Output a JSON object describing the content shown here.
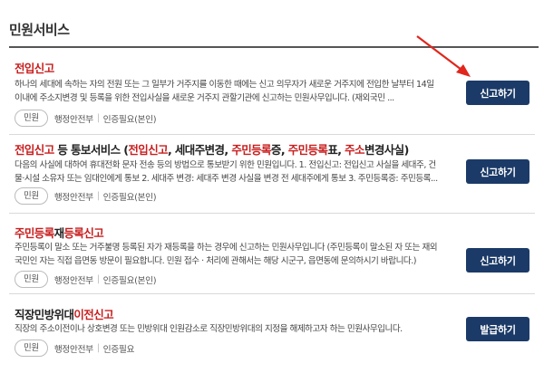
{
  "section": {
    "title": "민원서비스"
  },
  "items": [
    {
      "title_parts": [
        {
          "text": "전입신고",
          "hl": true
        }
      ],
      "desc_lines": [
        "하나의 세대에 속하는 자의 전원 또는 그 일부가 거주지를 이동한 때에는 신고 의무자가 새로운 거주지에 전입한 날부터 14일",
        "이내에 주소지변경 및 등록을 위한 전입사실을 새로운 거주지 관할기관에 신고하는 민원사무입니다. (재외국민 ..."
      ],
      "tag": "민원",
      "org": "행정안전부",
      "auth": "인증필요(본인)",
      "button": "신고하기"
    },
    {
      "title_parts": [
        {
          "text": "전입신고",
          "hl": true
        },
        {
          "text": " 등 통보서비스 (",
          "hl": false
        },
        {
          "text": "전입신고",
          "hl": true
        },
        {
          "text": ", 세대주변경, ",
          "hl": false
        },
        {
          "text": "주민등록",
          "hl": true
        },
        {
          "text": "증, ",
          "hl": false
        },
        {
          "text": "주민등록",
          "hl": true
        },
        {
          "text": "표, ",
          "hl": false
        },
        {
          "text": "주소",
          "hl": true
        },
        {
          "text": "변경사실)",
          "hl": false
        }
      ],
      "desc_lines": [
        "다음의 사실에 대하여 휴대전화 문자 전송 등의 방법으로 통보받기 위한 민원입니다. 1. 전입신고: 전입신고 사실을 세대주, 건",
        "물·시설 소유자 또는 임대인에게 통보 2. 세대주 변경: 세대주 변경 사실을 변경 전 세대주에게 통보 3. 주민등록증: 주민등록..."
      ],
      "tag": "민원",
      "org": "행정안전부",
      "auth": "인증필요(본인)",
      "button": "신고하기"
    },
    {
      "title_parts": [
        {
          "text": "주민등록",
          "hl": true
        },
        {
          "text": "재",
          "hl": false
        },
        {
          "text": "등록신고",
          "hl": true
        }
      ],
      "desc_lines": [
        "주민등록이 말소 또는 거주불명 등록된 자가 재등록을 하는 경우에 신고하는 민원사무입니다 (주민등록이 말소된 자 또는 재외",
        "국민인 자는 직접 읍면동 방문이 필요합니다. 민원 접수 · 처리에 관해서는 해당 시군구, 읍면동에 문의하시기 바랍니다.)"
      ],
      "tag": "민원",
      "org": "행정안전부",
      "auth": "인증필요(본인)",
      "button": "신고하기"
    },
    {
      "title_parts": [
        {
          "text": "직장민방위대",
          "hl": false
        },
        {
          "text": "이전신고",
          "hl": true
        }
      ],
      "desc_lines": [
        "직장의 주소이전이나 상호변경 또는 민방위대 인원감소로 직장민방위대의 지정을 해제하고자 하는 민원사무입니다."
      ],
      "tag": "민원",
      "org": "행정안전부",
      "auth": "인증필요",
      "button": "발급하기"
    }
  ],
  "colors": {
    "accent_red": "#c81e1e",
    "button_navy": "#1b3a67",
    "arrow_red": "#e0261d"
  }
}
